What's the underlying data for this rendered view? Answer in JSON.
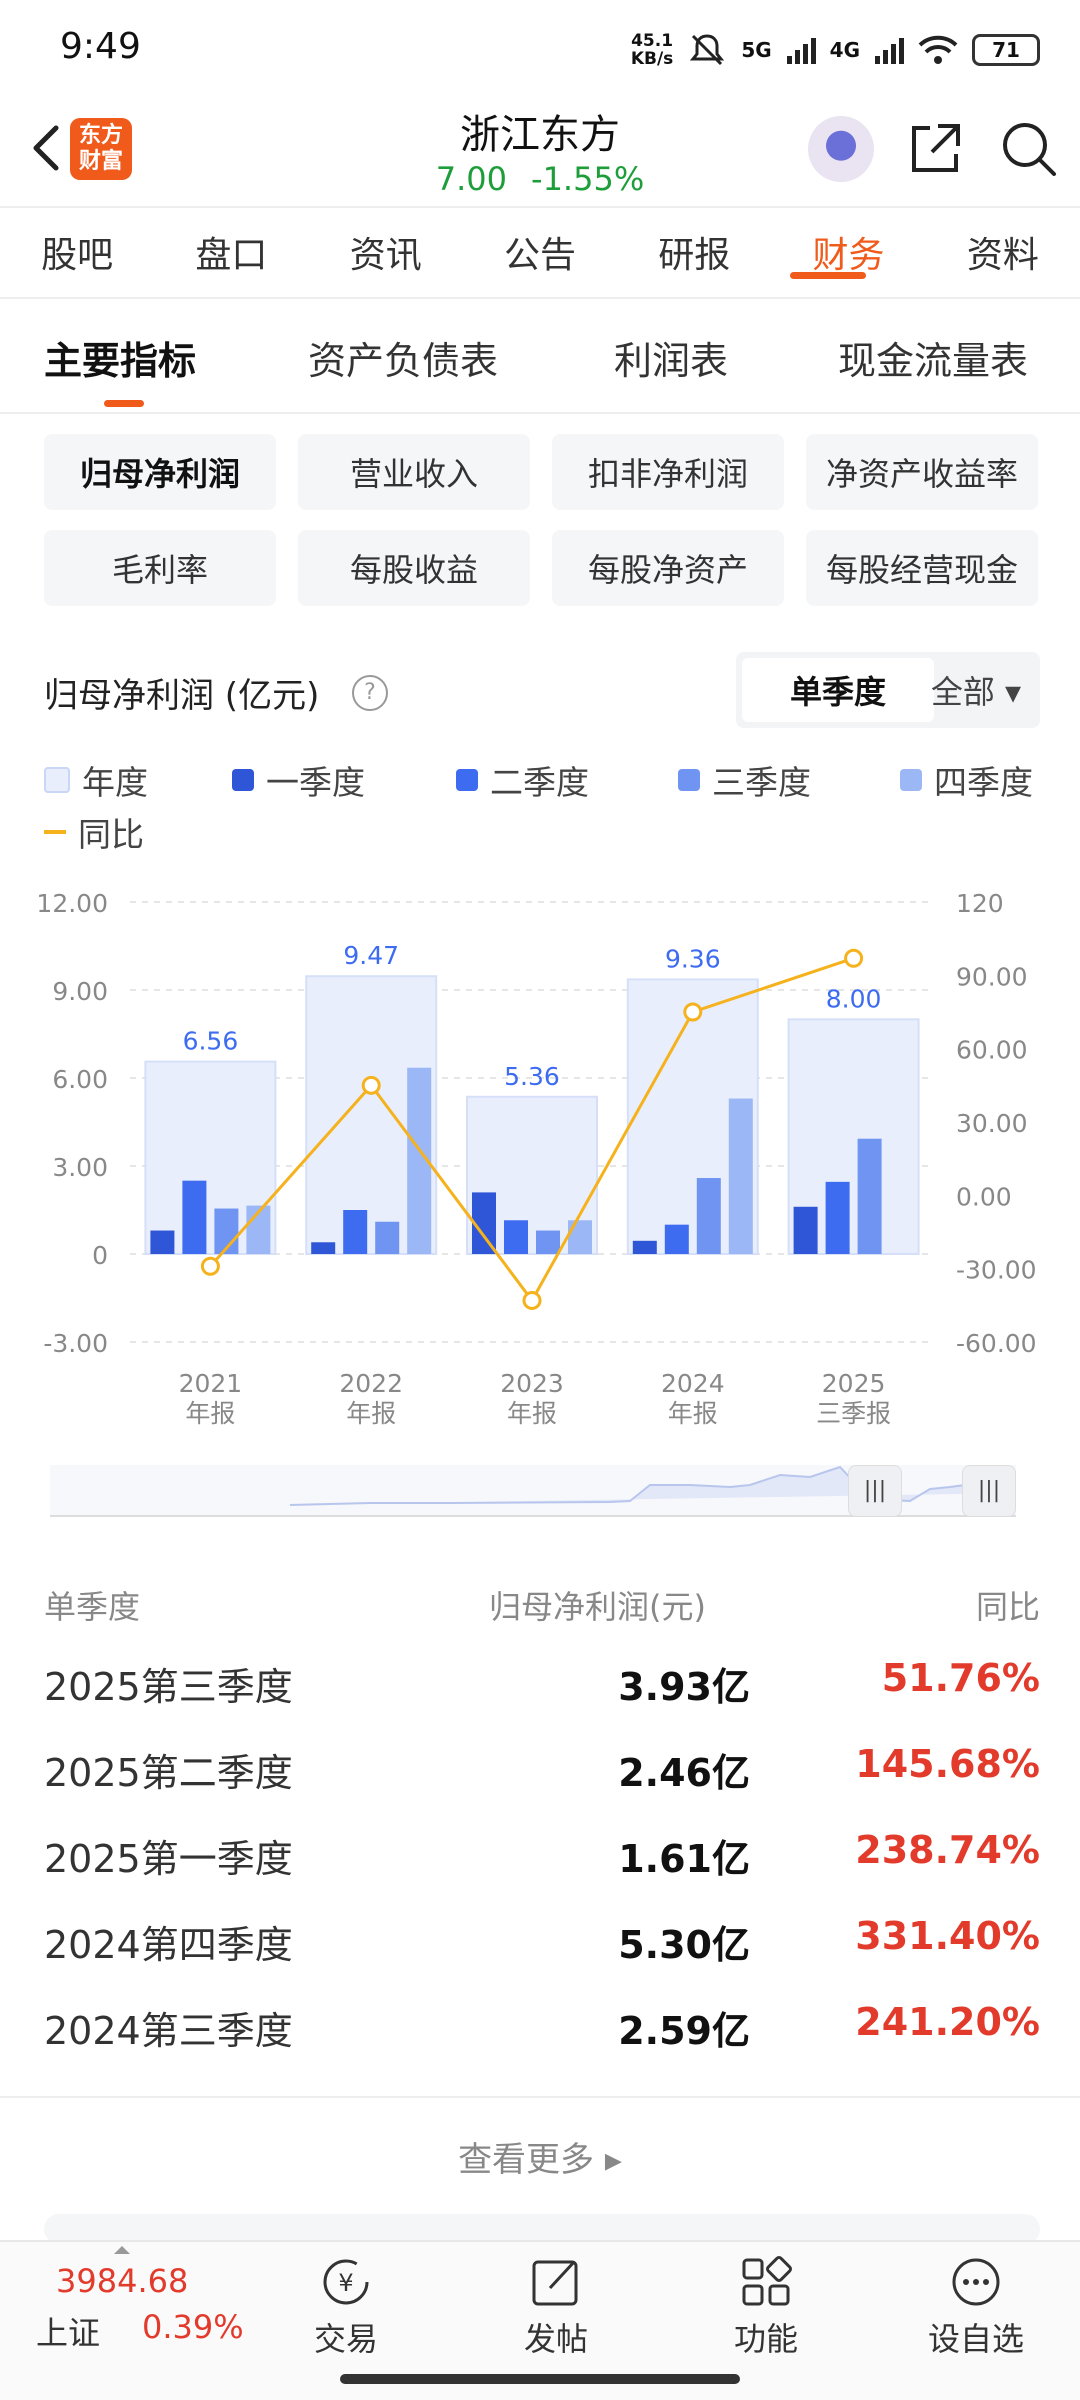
{
  "status_bar": {
    "time": "9:49",
    "net_speed_top": "45.1",
    "net_speed_bottom": "KB/s",
    "sig1": "5G",
    "sig2": "4G",
    "battery": "71"
  },
  "header": {
    "logo_line1": "东方",
    "logo_line2": "财富",
    "stock_name": "浙江东方",
    "price": "7.00",
    "change_pct": "-1.55%"
  },
  "nav_tabs": [
    "股吧",
    "盘口",
    "资讯",
    "公告",
    "研报",
    "财务",
    "资料"
  ],
  "sub_tabs": [
    "主要指标",
    "资产负债表",
    "利润表",
    "现金流量表"
  ],
  "metrics": [
    "归母净利润",
    "营业收入",
    "扣非净利润",
    "净资产收益率",
    "毛利率",
    "每股收益",
    "每股净资产",
    "每股经营现金"
  ],
  "chart_header": {
    "title": "归母净利润 (亿元)",
    "help": "?",
    "period_single": "单季度",
    "period_all": "全部 ▾"
  },
  "legend": {
    "year": "年度",
    "q1": "一季度",
    "q2": "二季度",
    "q3": "三季度",
    "q4": "四季度",
    "yoy": "同比"
  },
  "colors": {
    "year": "#e8eefc",
    "q1": "#2f56d6",
    "q2": "#3d6cf0",
    "q3": "#6f94f2",
    "q4": "#9bb7f6",
    "yoy": "#f5b21c",
    "accent": "#f05a1a",
    "up": "#e23b2c",
    "down": "#1e9e3a"
  },
  "chart_data": {
    "type": "bar",
    "categories": [
      "2021\n年报",
      "2022\n年报",
      "2023\n年报",
      "2024\n年报",
      "2025\n三季报"
    ],
    "category_top": [
      "2021",
      "2022",
      "2023",
      "2024",
      "2025"
    ],
    "category_bottom": [
      "年报",
      "年报",
      "年报",
      "年报",
      "三季报"
    ],
    "series": [
      {
        "name": "年度",
        "values": [
          6.56,
          9.47,
          5.36,
          9.36,
          8.0
        ],
        "labels": [
          "6.56",
          "9.47",
          "5.36",
          "9.36",
          "8.00"
        ]
      },
      {
        "name": "一季度",
        "values": [
          0.8,
          0.4,
          2.1,
          0.45,
          1.61
        ]
      },
      {
        "name": "二季度",
        "values": [
          2.5,
          1.5,
          1.15,
          1.0,
          2.46
        ]
      },
      {
        "name": "三季度",
        "values": [
          1.55,
          1.1,
          0.8,
          2.59,
          3.93
        ]
      },
      {
        "name": "四季度",
        "values": [
          1.65,
          6.35,
          1.15,
          5.3,
          null
        ]
      },
      {
        "name": "同比",
        "axis": "right",
        "values": [
          -29,
          45,
          -43,
          75,
          97
        ]
      }
    ],
    "y_left": {
      "ticks": [
        "12.00",
        "9.00",
        "6.00",
        "3.00",
        "0",
        "-3.00"
      ],
      "ylim": [
        -3,
        12
      ]
    },
    "y_right": {
      "ticks": [
        "120",
        "90.00",
        "60.00",
        "30.00",
        "0.00",
        "-30.00",
        "-60.00"
      ],
      "ylim": [
        -60,
        120
      ]
    },
    "grid": true
  },
  "table": {
    "headers": [
      "单季度",
      "归母净利润(元)",
      "同比"
    ],
    "rows": [
      [
        "2025第三季度",
        "3.93亿",
        "51.76%"
      ],
      [
        "2025第二季度",
        "2.46亿",
        "145.68%"
      ],
      [
        "2025第一季度",
        "1.61亿",
        "238.74%"
      ],
      [
        "2024第四季度",
        "5.30亿",
        "331.40%"
      ],
      [
        "2024第三季度",
        "2.59亿",
        "241.20%"
      ]
    ],
    "more": "查看更多 ▸"
  },
  "bottom_bar": {
    "index_value": "3984.68",
    "index_name": "上证",
    "index_pct": "0.39%",
    "trade": "交易",
    "post": "发帖",
    "functions": "功能",
    "watchlist": "设自选"
  }
}
